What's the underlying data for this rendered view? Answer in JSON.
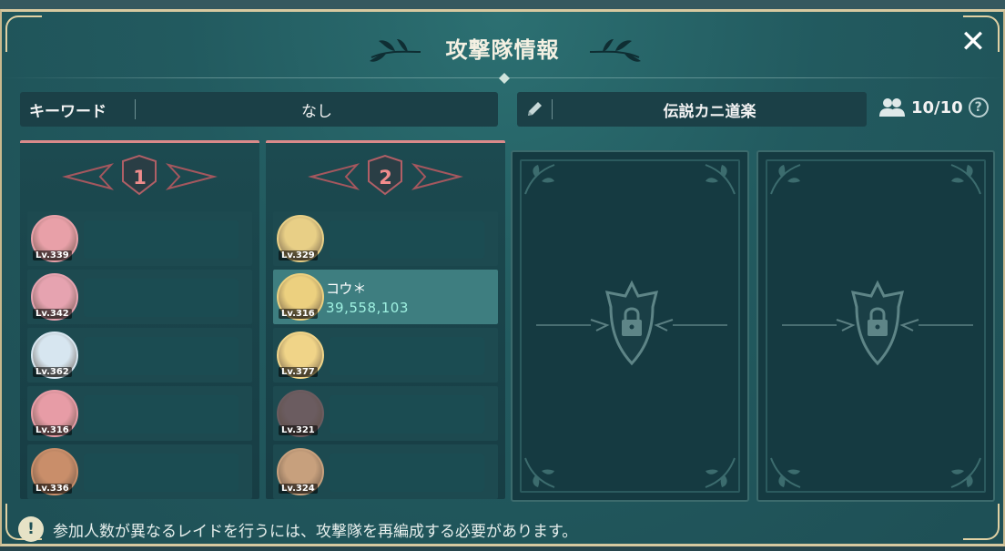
{
  "header": {
    "title": "攻撃隊情報",
    "close_label": "✕"
  },
  "search": {
    "keyword_label": "キーワード",
    "keyword_value": "なし"
  },
  "squad": {
    "name": "伝説カニ道楽",
    "member_count": "10/10",
    "help_label": "?"
  },
  "parties": [
    {
      "number": "1",
      "slots": [
        {
          "level": "Lv.339",
          "name": "",
          "power": "",
          "avatar_color": "#e8a0a8"
        },
        {
          "level": "Lv.342",
          "name": "",
          "power": "",
          "avatar_color": "#e6a3b0"
        },
        {
          "level": "Lv.362",
          "name": "",
          "power": "",
          "avatar_color": "#d7e6f0"
        },
        {
          "level": "Lv.316",
          "name": "",
          "power": "",
          "avatar_color": "#e79ca6"
        },
        {
          "level": "Lv.336",
          "name": "",
          "power": "",
          "avatar_color": "#c98e6a"
        }
      ]
    },
    {
      "number": "2",
      "slots": [
        {
          "level": "Lv.329",
          "name": "",
          "power": "",
          "avatar_color": "#e8cf86"
        },
        {
          "level": "Lv.316",
          "name": "コウ＊",
          "power": "39,558,103",
          "avatar_color": "#ecd07f"
        },
        {
          "level": "Lv.377",
          "name": "",
          "power": "",
          "avatar_color": "#f0d488"
        },
        {
          "level": "Lv.321",
          "name": "",
          "power": "",
          "avatar_color": "#6b5c60"
        },
        {
          "level": "Lv.324",
          "name": "",
          "power": "",
          "avatar_color": "#c7a07d"
        }
      ]
    }
  ],
  "notice": {
    "icon": "!",
    "text": "参加人数が異なるレイドを行うには、攻撃隊を再編成する必要があります。"
  },
  "colors": {
    "accent_party": "#f08c8c",
    "power_text": "#9ef0e0",
    "frame_gold": "#d7c9a0",
    "panel_bg": "#1c4a50"
  },
  "icons": {
    "close": "close-icon",
    "edit": "pencil-icon",
    "members": "people-icon",
    "help": "help-icon",
    "lock": "lock-icon",
    "notice": "exclamation-icon"
  }
}
